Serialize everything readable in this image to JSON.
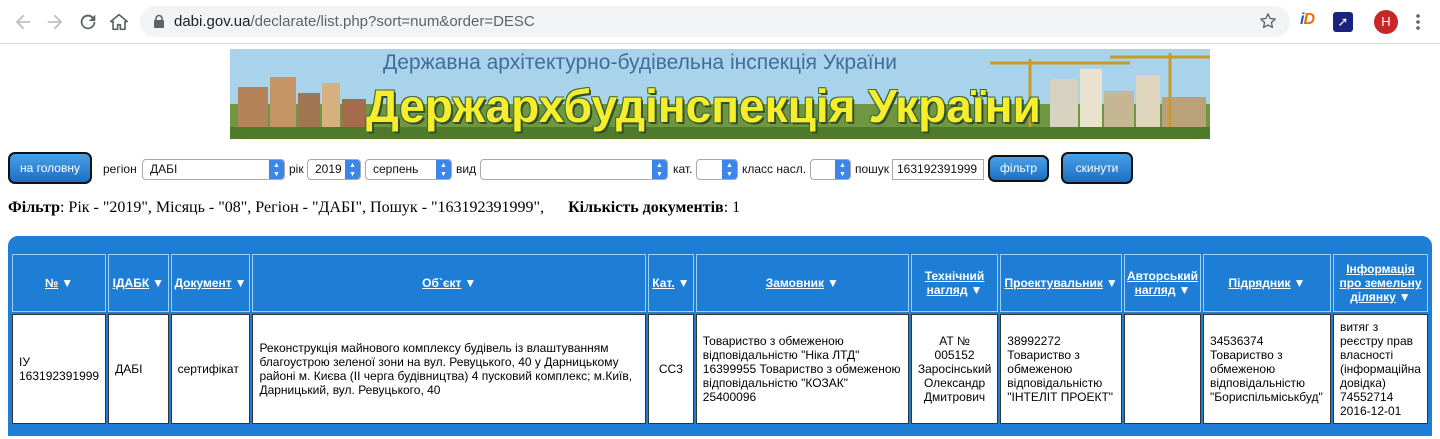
{
  "browser": {
    "url_host": "dabi.gov.ua",
    "url_path": "/declarate/list.php?sort=num&order=DESC",
    "avatar_letter": "H",
    "icons": [
      "back-arrow-icon",
      "forward-arrow-icon",
      "reload-icon",
      "home-icon",
      "lock-icon",
      "star-icon",
      "extension-id-icon",
      "extension-rocket-icon",
      "kebab-menu-icon"
    ]
  },
  "banner": {
    "subtitle": "Державна архітектурно-будівельна інспекція України",
    "title": "Держархбудінспекція України"
  },
  "filters": {
    "home_button": "на головну",
    "region_label": "регіон",
    "region_value": "ДАБІ",
    "year_label": "рік",
    "year_value": "2019",
    "month_value": "серпень",
    "type_label": "вид",
    "type_value": "",
    "category_label": "кат.",
    "category_value": "",
    "class_label": "класс насл.",
    "class_value": "",
    "search_label": "пошук",
    "search_value": "163192391999",
    "filter_button": "фільтр",
    "reset_button": "скинути"
  },
  "summary": {
    "filter_label": "Фільтр",
    "filter_text": ": Рік - \"2019\", Місяць - \"08\", Регіон - \"ДАБІ\", Пошук - \"163192391999\",",
    "count_label": "Кількість документів",
    "count_value": ": 1"
  },
  "table": {
    "headers": {
      "num": "№",
      "idabk": "ІДАБК",
      "document": "Документ",
      "object": "Об`єкт",
      "category": "Кат.",
      "customer": "Замовник",
      "tech_1": "Технічний",
      "tech_2": "нагляд",
      "designer": "Проектувальник",
      "author_1": "Авторський",
      "author_2": "нагляд",
      "contractor": "Підрядник",
      "land_1": "Інформація",
      "land_2": "про земельну",
      "land_3": "ділянку"
    },
    "rows": [
      {
        "num": "ІУ 163192391999",
        "idabk": "ДАБІ",
        "document": "сертифікат",
        "object": "Реконструкція майнового комплексу будівель із влаштуванням благоустрою зеленої зони на вул. Ревуцького, 40 у Дарницькому районі м. Києва (ІІ черга будівництва) 4 пусковий комплекс; м.Київ, Дарницький, вул. Ревуцького, 40",
        "category": "СС3",
        "customer": "Товариство з обмеженою відповідальністю \"Ніка ЛТД\" 16399955 Товариство з обмеженою відповідальністю \"КОЗАК\" 25400096",
        "tech": "АТ № 005152 Заросінський Олександр Дмитрович",
        "designer": "38992272 Товариство з обмеженою відповідальністю \"ІНТЕЛІТ ПРОЕКТ\"",
        "author": "",
        "contractor": "34536374 Товариство з обмеженою відповідальністю \"Бориспільміськбуд\"",
        "land": "витяг з реєстру прав власності (інформаційна довідка) 74552714 2016-12-01"
      }
    ]
  }
}
